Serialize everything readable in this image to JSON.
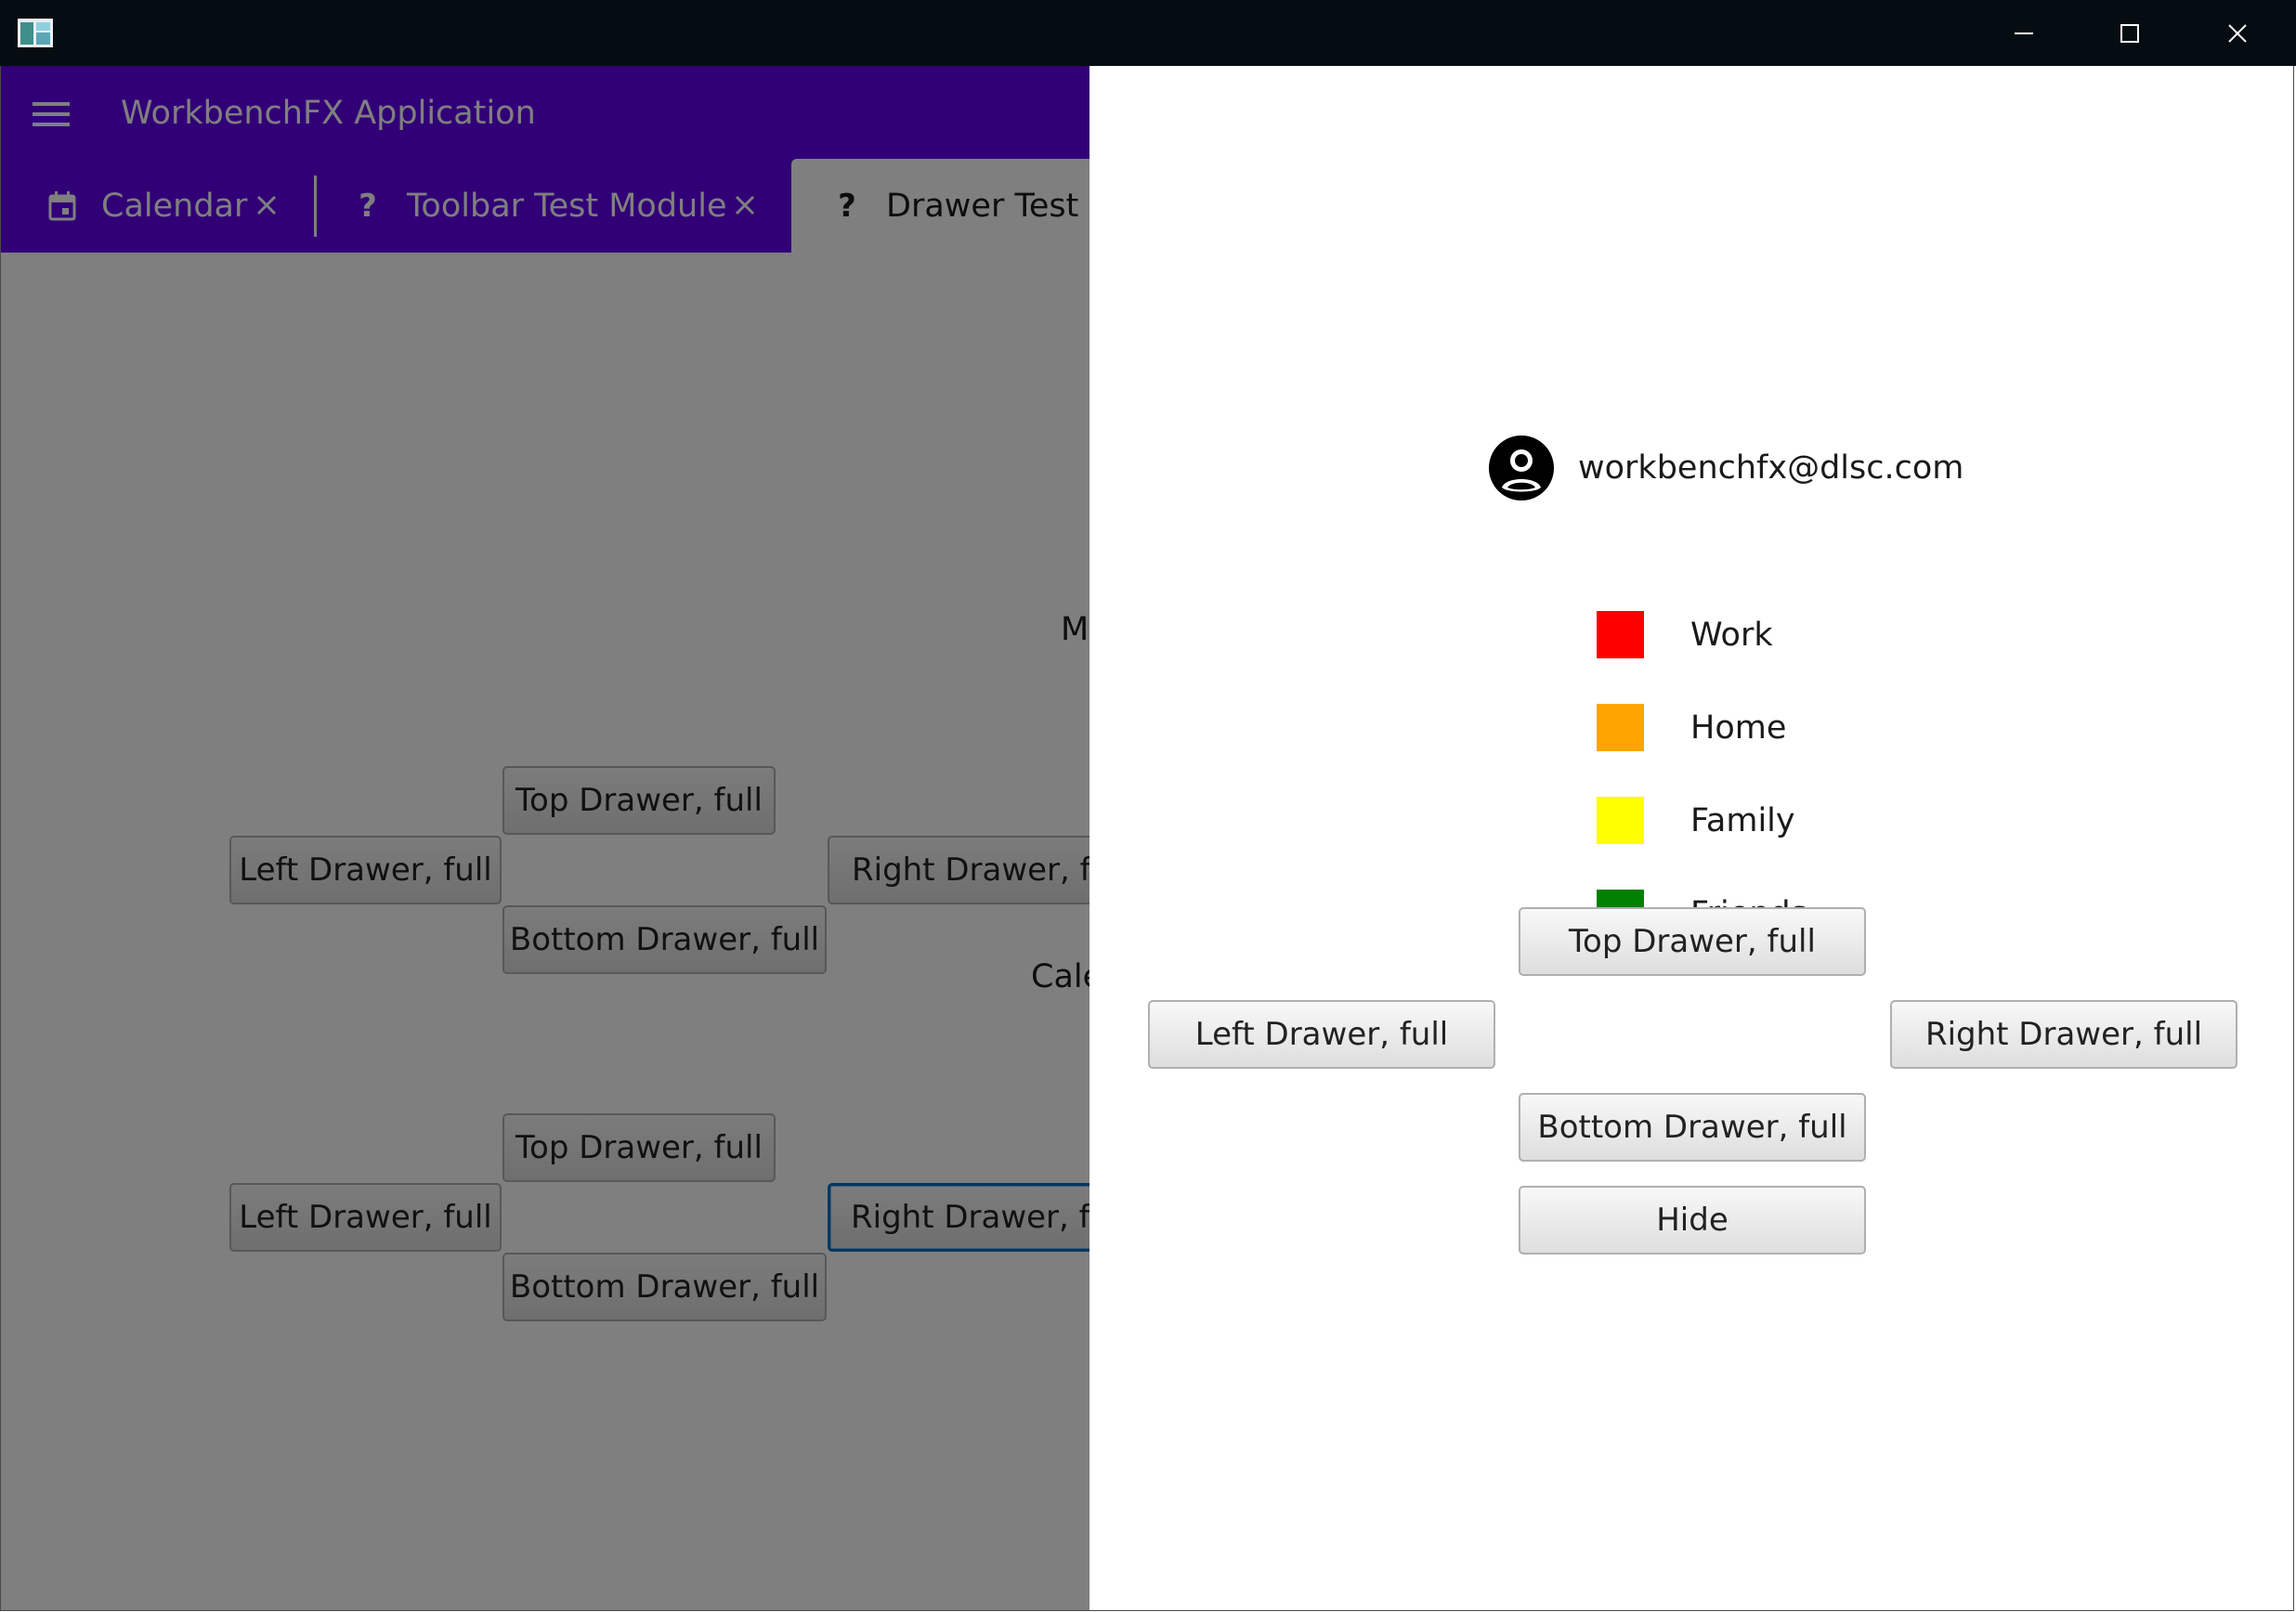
{
  "app": {
    "title": "WorkbenchFX Application"
  },
  "tabs": [
    {
      "label": "Calendar",
      "icon": "calendar-icon"
    },
    {
      "label": "Toolbar Test Module",
      "icon": "question-icon",
      "icon_glyph": "?"
    },
    {
      "label": "Drawer Test",
      "icon": "question-icon",
      "icon_glyph": "?"
    }
  ],
  "background": {
    "labels": [
      "M",
      "Cale"
    ],
    "group1": {
      "top": "Top Drawer, full",
      "left": "Left Drawer, full",
      "right": "Right Drawer, ful",
      "bottom": "Bottom Drawer, full"
    },
    "group2": {
      "top": "Top Drawer, full",
      "left": "Left Drawer, full",
      "right": "Right Drawer, ful",
      "bottom": "Bottom Drawer, full"
    }
  },
  "drawer": {
    "user_email": "workbenchfx@dlsc.com",
    "calendars": [
      {
        "label": "Work",
        "color": "#ff0000"
      },
      {
        "label": "Home",
        "color": "#ffa500"
      },
      {
        "label": "Family",
        "color": "#ffff00"
      },
      {
        "label": "Friends",
        "color": "#008000"
      }
    ],
    "buttons": {
      "top": "Top Drawer, full",
      "left": "Left Drawer, full",
      "right": "Right Drawer, full",
      "bottom": "Bottom Drawer, full",
      "hide": "Hide"
    }
  },
  "colors": {
    "header": "#6200ee",
    "focus": "#0b6ebf"
  }
}
